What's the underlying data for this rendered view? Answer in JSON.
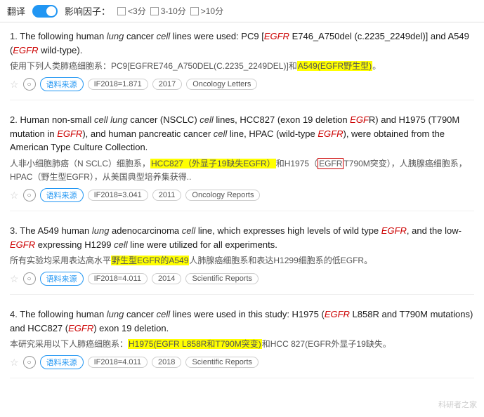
{
  "header": {
    "translate_label": "翻译",
    "factor_label": "影响因子：",
    "factors": [
      {
        "label": "<3分",
        "checked": false
      },
      {
        "label": "3-10分",
        "checked": false
      },
      {
        "label": ">10分",
        "checked": false
      }
    ]
  },
  "results": [
    {
      "id": 1,
      "en_text": "The following human lung cancer cell lines were used: PC9 [EGFR E746_A750del (c.2235_2249del)] and A549 (EGFR wild-type).",
      "cn_text": "使用下列人类肺癌细胞系：PC9[EGFRE746_A750DEL(C.2235_2249DEL)]和A549(EGFR野生型)。",
      "cn_highlight": "A549(EGFR野生型)",
      "if_value": "IF2018=1.871",
      "year": "2017",
      "journal": "Oncology Letters"
    },
    {
      "id": 2,
      "en_text": "Human non-small cell lung cancer (NSCLC) cell lines, HCC827 (exon 19 deletion EGFR) and H1975 (T790M mutation in EGFR), and human pancreatic cancer cell line, HPAC (wild-type EGFR), were obtained from the American Type Culture Collection.",
      "cn_text": "人非小细胞肺癌（N SCLC）细胞系，HCC827（外显子19缺失EGFR）和H1975（EGFR T790M突变），人胰腺癌细胞系，HPAC（野生型EGFR），从美国典型培养集获得..",
      "cn_highlight1": "HCC827（外显子19缺失EGFR）",
      "cn_highlight2": "H1975（EGFR",
      "if_value": "IF2018=3.041",
      "year": "2011",
      "journal": "Oncology Reports"
    },
    {
      "id": 3,
      "en_text": "The A549 human lung adenocarcinoma cell line, which expresses high levels of wild type EGFR, and the low-EGFR expressing H1299 cell line were utilized for all experiments.",
      "cn_text": "所有实验均采用表达高水平野生型EGFR的A549人肺腺癌细胞系和表达H1299细胞系的低EGFR。",
      "cn_highlight": "野生型EGFR的A549",
      "if_value": "IF2018=4.011",
      "year": "2014",
      "journal": "Scientific Reports"
    },
    {
      "id": 4,
      "en_text": "The following human lung cancer cell lines were used in this study: H1975 (EGFR L858R and T790M mutations) and HCC827 (EGFR exon 19 deletion.",
      "cn_text": "本研究采用以下人肺癌细胞系：H1975(EGFR L858R和T790M突变)和HCC 827(EGFR外显子19缺失。",
      "cn_highlight": "H1975(EGFR L858R和T790M突变)",
      "if_value": "IF2018=4.011",
      "year": "2018",
      "journal": "Scientific Reports"
    }
  ],
  "watermark": "科研者之家"
}
